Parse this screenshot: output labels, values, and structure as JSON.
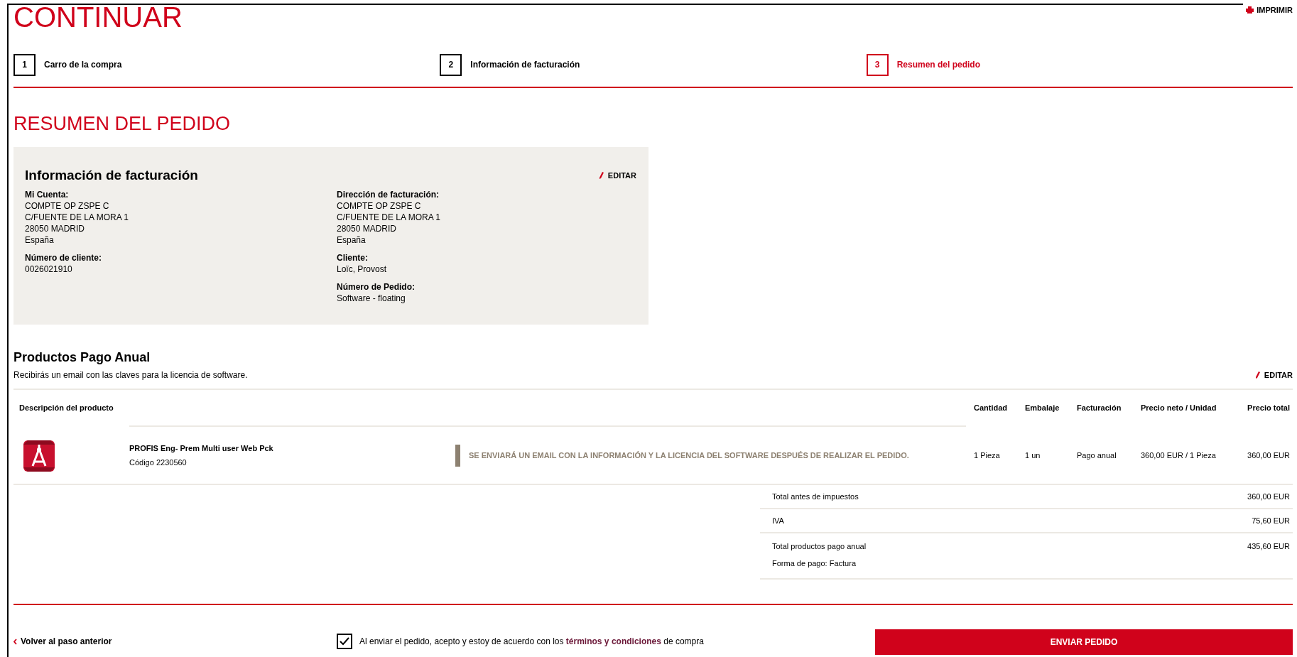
{
  "header": {
    "title": "CONTINUAR",
    "print_link": "IMPRIMIR"
  },
  "steps": [
    {
      "number": "1",
      "label": "Carro de la compra",
      "selected": false
    },
    {
      "number": "2",
      "label": "Información de facturación",
      "selected": false
    },
    {
      "number": "3",
      "label": "Resumen del pedido",
      "selected": true
    }
  ],
  "page_title": "RESUMEN DEL PEDIDO",
  "billing": {
    "title": "Información de facturación",
    "edit": "EDITAR",
    "left": [
      {
        "label": "Mi Cuenta:",
        "lines": [
          "COMPTE OP ZSPE C",
          "C/FUENTE DE LA MORA 1",
          "28050 MADRID",
          "España"
        ]
      },
      {
        "label": "Número de cliente:",
        "lines": [
          "0026021910"
        ]
      }
    ],
    "right": [
      {
        "label": "Dirección de facturación:",
        "lines": [
          "COMPTE OP ZSPE C",
          "C/FUENTE DE LA MORA 1",
          "28050 MADRID",
          "España"
        ]
      },
      {
        "label": "Cliente:",
        "lines": [
          "Loïc, Provost"
        ]
      },
      {
        "label": "Número de Pedido:",
        "lines": [
          "Software - floating"
        ]
      }
    ]
  },
  "products": {
    "title": "Productos Pago Anual",
    "subtitle": "Recibirás un email con las claves para la licencia de software.",
    "edit": "EDITAR",
    "columns": [
      "Descripción del producto",
      "Cantidad",
      "Embalaje",
      "Facturación",
      "Precio neto / Unidad",
      "Precio total"
    ],
    "rows": [
      {
        "name": "PROFIS Eng- Prem Multi user Web Pck",
        "code": "Código 2230560",
        "notice": "SE ENVIARÁ UN EMAIL CON LA INFORMACIÓN Y LA LICENCIA DEL SOFTWARE DESPUÉS DE REALIZAR EL PEDIDO.",
        "quantity": "1 Pieza",
        "packaging": "1 un",
        "billing": "Pago anual",
        "unit_price": "360,00 EUR / 1 Pieza",
        "total": "360,00 EUR"
      }
    ],
    "totals": [
      {
        "label": "Total antes de impuestos",
        "value": "360,00 EUR"
      },
      {
        "label": "IVA",
        "value": "75,60 EUR"
      },
      {
        "label": "Total productos pago anual",
        "value": "435,60 EUR",
        "note": "Forma de pago: Factura"
      }
    ]
  },
  "footer": {
    "back": "Volver al paso anterior",
    "terms_checked": true,
    "terms": "Al enviar el pedido, acepto y estoy de acuerdo con los **términos y condiciones** de compra",
    "submit": "ENVIAR PEDIDO"
  }
}
